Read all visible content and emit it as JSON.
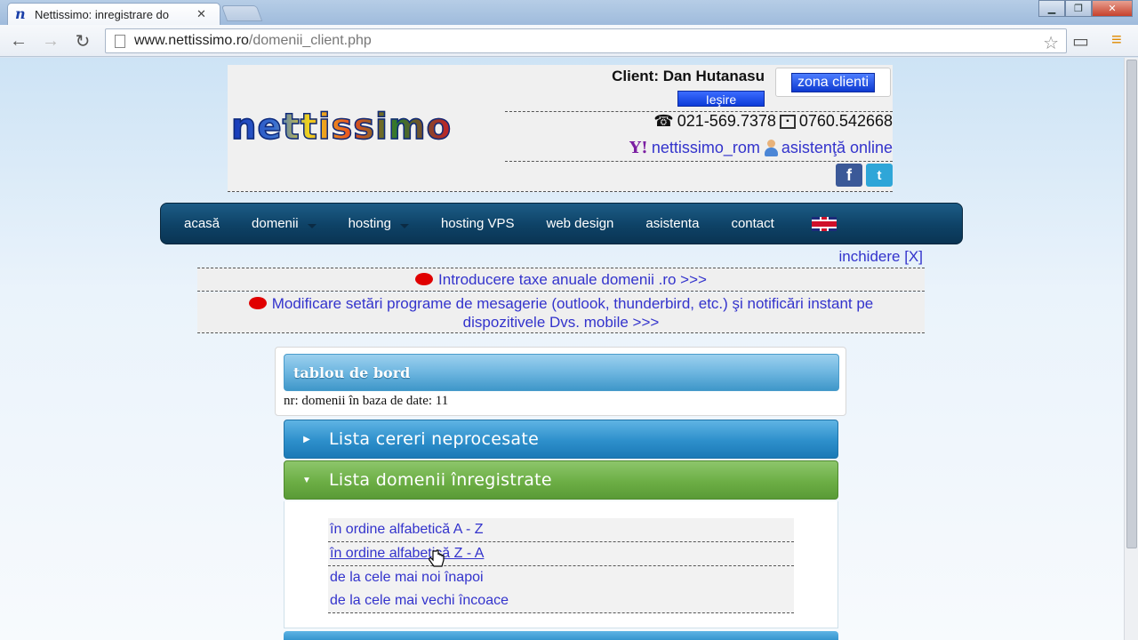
{
  "browser": {
    "tab_title": "Nettissimo: inregistrare do",
    "tab_favicon": "n",
    "url_host": "www.nettissimo.ro",
    "url_path": "/domenii_client.php"
  },
  "header": {
    "logo_text": "nettissimo",
    "client_label": "Client: Dan Hutanasu",
    "logout_label": "Ieşire",
    "client_zone_label": "zona clienti",
    "phone": "021-569.7378",
    "mobile": "0760.542668",
    "yahoo_id": "nettissimo_rom",
    "online_support": "asistenţă online",
    "facebook_glyph": "f",
    "twitter_glyph": "t"
  },
  "nav": {
    "items": [
      {
        "label": "acasă",
        "dropdown": false
      },
      {
        "label": "domenii",
        "dropdown": true
      },
      {
        "label": "hosting",
        "dropdown": true
      },
      {
        "label": "hosting VPS",
        "dropdown": false
      },
      {
        "label": "web design",
        "dropdown": false
      },
      {
        "label": "asistenta",
        "dropdown": false
      },
      {
        "label": "contact",
        "dropdown": false
      }
    ]
  },
  "news": {
    "close_label": "inchidere [X]",
    "item1": "Introducere taxe anuale domenii .ro >>>",
    "item2_line1": "Modificare setări programe de mesagerie (outlook, thunderbird, etc.) şi notificări instant pe",
    "item2_line2": "dispozitivele Dvs. mobile >>>"
  },
  "dashboard": {
    "title": "tablou de bord",
    "text": "nr: domenii în baza de date: 11"
  },
  "accordion": {
    "section1": "Lista cereri neprocesate",
    "section2": "Lista domenii înregistrate",
    "links": [
      "în ordine alfabetică A - Z",
      "în ordine alfabetică Z - A",
      "de la cele mai noi înapoi",
      "de la cele mai vechi încoace"
    ]
  },
  "colors": {
    "nav_bg": "#0e4266",
    "link": "#3333cc",
    "accordion_blue": "#2d8fcb",
    "accordion_green": "#6cae45",
    "alert_dot": "#e00000"
  }
}
